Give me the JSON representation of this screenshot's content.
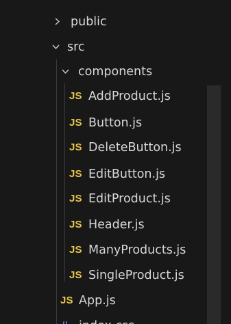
{
  "explorer": {
    "folders": {
      "public": {
        "label": "public",
        "icon": "chevron-right-icon",
        "expanded": false
      },
      "src": {
        "label": "src",
        "icon": "chevron-down-icon",
        "expanded": true
      },
      "components": {
        "label": "components",
        "icon": "chevron-down-icon",
        "expanded": true
      }
    },
    "component_files": [
      {
        "badge": "JS",
        "name": "AddProduct.js"
      },
      {
        "badge": "JS",
        "name": "Button.js"
      },
      {
        "badge": "JS",
        "name": "DeleteButton.js"
      },
      {
        "badge": "JS",
        "name": "EditButton.js"
      },
      {
        "badge": "JS",
        "name": "EditProduct.js"
      },
      {
        "badge": "JS",
        "name": "Header.js"
      },
      {
        "badge": "JS",
        "name": "ManyProducts.js"
      },
      {
        "badge": "JS",
        "name": "SingleProduct.js"
      }
    ],
    "src_files": [
      {
        "badge": "JS",
        "name": "App.js"
      },
      {
        "badge": "#",
        "name": "index.css"
      }
    ]
  },
  "colors": {
    "background": "#181818",
    "text": "#d7d7d7",
    "js_badge": "#e8c84a",
    "css_badge": "#5b8fd6",
    "indent_guide": "#3c3c3c"
  }
}
